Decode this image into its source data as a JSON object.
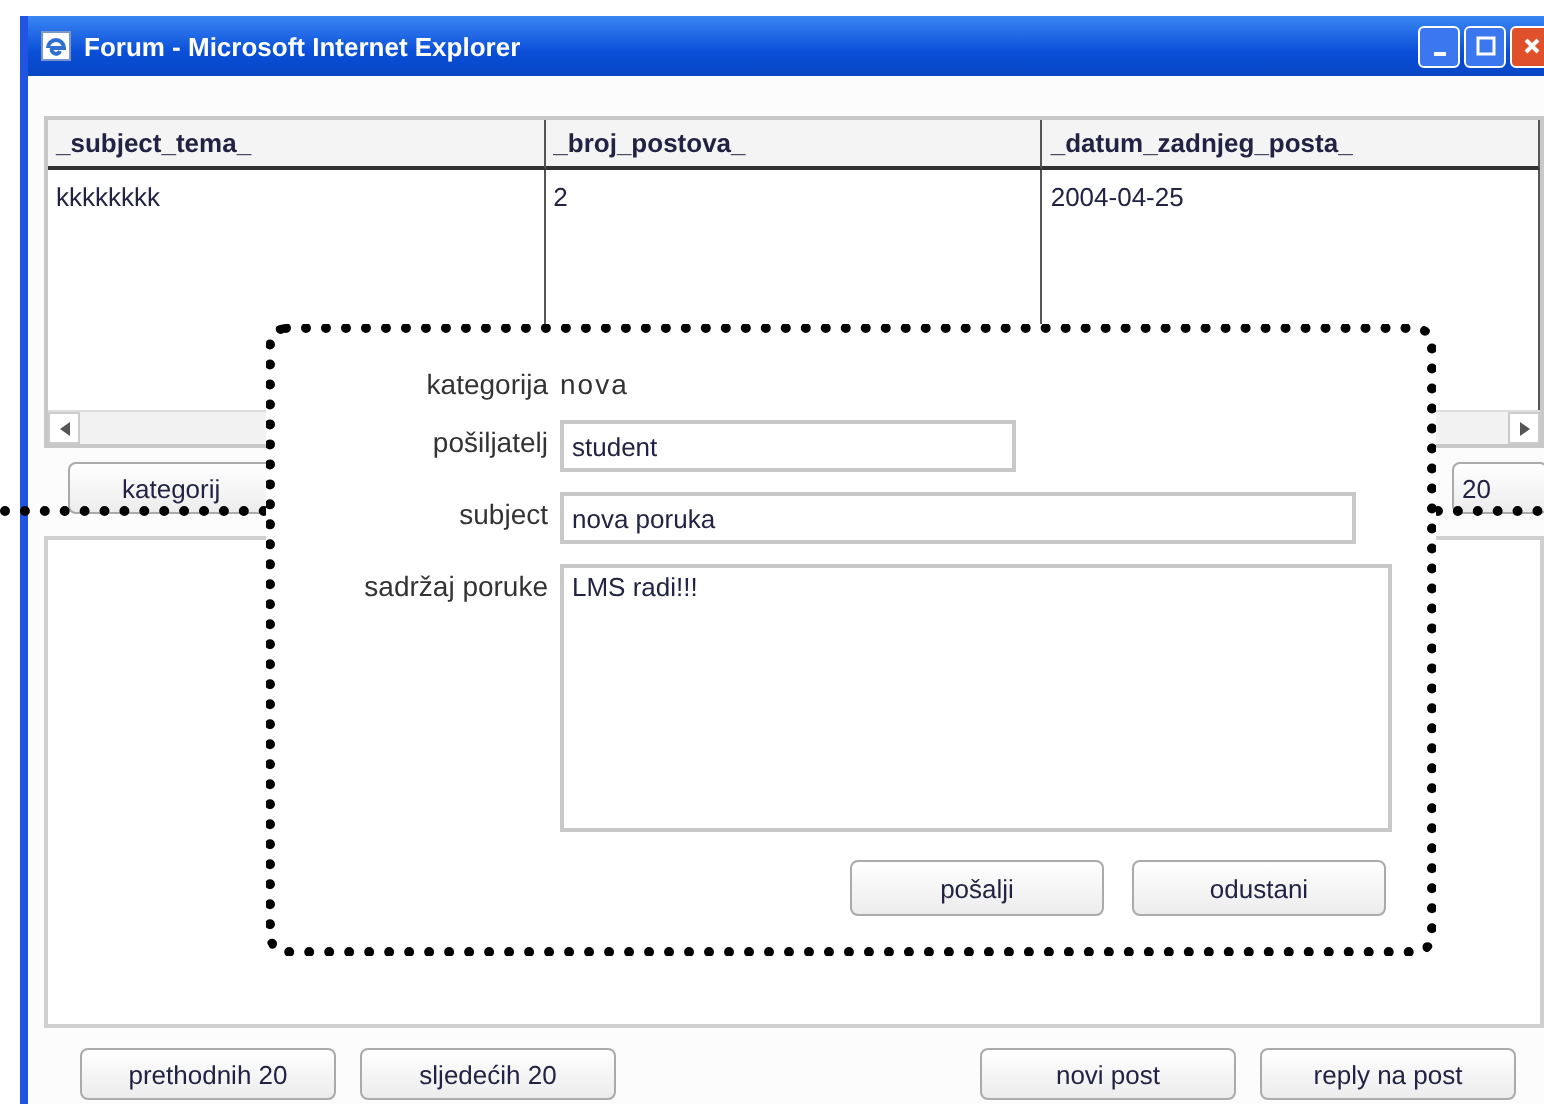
{
  "window": {
    "title": "Forum - Microsoft Internet Explorer"
  },
  "table": {
    "columns": [
      "_subject_tema_",
      "_broj_postova_",
      "_datum_zadnjeg_posta_"
    ],
    "rows": [
      [
        "kkkkkkkk",
        "2",
        "2004-04-25"
      ]
    ]
  },
  "top_buttons": [
    "kategorij",
    "20"
  ],
  "bottom_buttons": [
    "prethodnih 20",
    "sljedećih 20",
    "novi post",
    "reply na post"
  ],
  "dialog": {
    "category_label": "kategorija",
    "category_value": "nova",
    "fields": [
      {
        "label": "pošiljatelj",
        "value": "student",
        "kind": "short"
      },
      {
        "label": "subject",
        "value": "nova poruka",
        "kind": "long"
      },
      {
        "label": "sadržaj poruke",
        "value": "LMS radi!!!",
        "kind": "multiline"
      }
    ],
    "buttons": [
      "pošalji",
      "odustani"
    ]
  }
}
